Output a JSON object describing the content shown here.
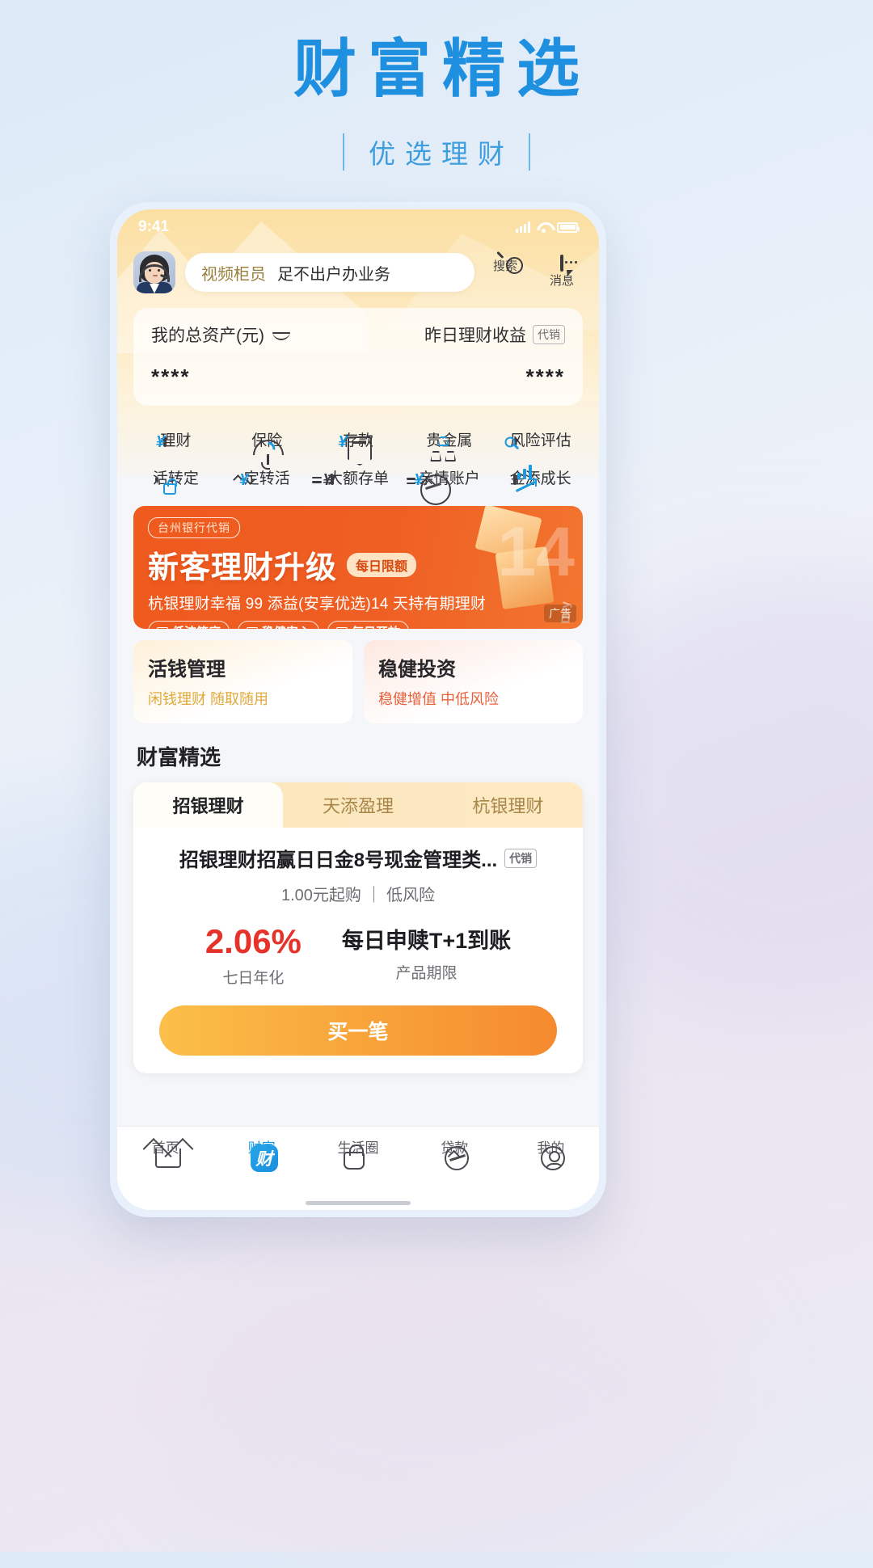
{
  "poster": {
    "title": "财富精选",
    "subtitle": "优选理财"
  },
  "colors": {
    "poster_blue": "#1f8fe0",
    "accent_orange": "#ef5a1e",
    "rate_red": "#e6332a",
    "icon_blue": "#1c9ae0",
    "gold": "#e0a93c"
  },
  "status_bar": {
    "time": "9:41"
  },
  "app_header": {
    "avatar_name": "avatar",
    "teller_label": "视频柜员",
    "teller_desc": "足不出户办业务",
    "search_label": "搜索",
    "message_label": "消息"
  },
  "asset_card": {
    "total_label": "我的总资产(元)",
    "total_value": "****",
    "yesterday_label": "昨日理财收益",
    "yesterday_badge": "代销",
    "yesterday_value": "****"
  },
  "quick_grid": {
    "row1": [
      {
        "label": "理财",
        "icon": "wealth-doc-icon"
      },
      {
        "label": "保险",
        "icon": "umbrella-icon"
      },
      {
        "label": "存款",
        "icon": "deposit-icon"
      },
      {
        "label": "贵金属",
        "icon": "metal-icon"
      },
      {
        "label": "风险评估",
        "icon": "risk-assess-icon"
      }
    ],
    "row2": [
      {
        "label": "活转定",
        "icon": "current-to-fixed-icon"
      },
      {
        "label": "定转活",
        "icon": "fixed-to-current-icon"
      },
      {
        "label": "大额存单",
        "icon": "large-cd-icon"
      },
      {
        "label": "亲情账户",
        "icon": "family-account-icon"
      },
      {
        "label": "金添成长",
        "icon": "growth-chart-icon"
      }
    ]
  },
  "banner": {
    "tag": "台州银行代销",
    "title": "新客理财升级",
    "pill": "每日限额",
    "subtitle": "杭银理财幸福 99 添益(安享优选)14 天持有期理财",
    "chips": [
      "低波筑底",
      "稳健安心",
      "每日开放"
    ],
    "art_number": "14",
    "art_unit": "Day",
    "ad_tag": "广告"
  },
  "two_cards": [
    {
      "title": "活钱管理",
      "sub": "闲钱理财 随取随用"
    },
    {
      "title": "稳健投资",
      "sub": "稳健增值 中低风险"
    }
  ],
  "section": {
    "title": "财富精选"
  },
  "product": {
    "tabs": [
      {
        "label": "招银理财",
        "active": true
      },
      {
        "label": "天添盈理",
        "active": false
      },
      {
        "label": "杭银理财",
        "active": false
      }
    ],
    "name": "招银理财招赢日日金8号现金管理类...",
    "badge": "代销",
    "meta": "1.00元起购 ｜ 低风险",
    "rate": "2.06%",
    "rate_label": "七日年化",
    "term": "每日申赎T+1到账",
    "term_label": "产品期限",
    "buy_label": "买一笔"
  },
  "tabbar": [
    {
      "label": "首页",
      "icon": "home-icon",
      "active": false
    },
    {
      "label": "财富",
      "icon": "wealth-icon",
      "active": true
    },
    {
      "label": "生活圈",
      "icon": "life-bag-icon",
      "active": false
    },
    {
      "label": "贷款",
      "icon": "loan-icon",
      "active": false
    },
    {
      "label": "我的",
      "icon": "person-icon",
      "active": false
    }
  ]
}
